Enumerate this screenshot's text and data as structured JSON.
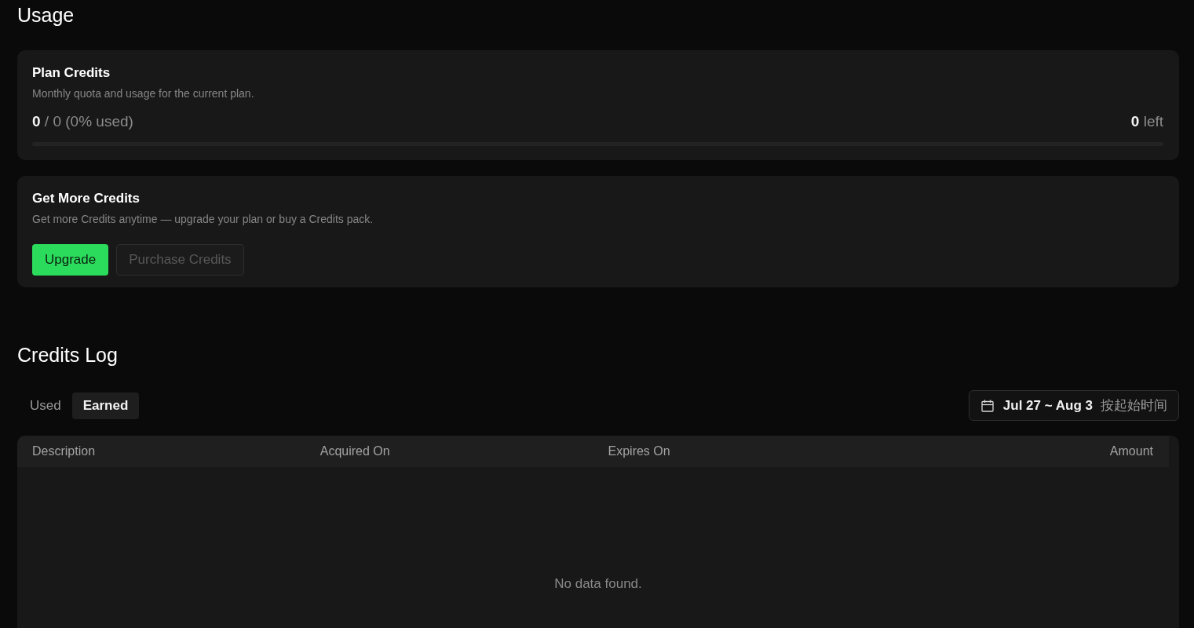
{
  "page_title": "Usage",
  "plan_credits": {
    "title": "Plan Credits",
    "description": "Monthly quota and usage for the current plan.",
    "usage": "**0** / 0 (0% used)",
    "remaining": "**0** left",
    "level": 0
  },
  "get_more_credits": {
    "title": "Get More Credits",
    "description": "Get more Credits anytime — upgrade your plan or buy a Credits pack.",
    "buttons": [
      {
        "label": "Upgrade",
        "kind": "primary",
        "disabled": false
      },
      {
        "label": "Purchase Credits",
        "kind": "outline",
        "disabled": true
      }
    ]
  },
  "credits_log": {
    "title": "Credits Log",
    "tabs": [
      {
        "label": "Used",
        "selected": false
      },
      {
        "label": "Earned",
        "selected": true
      }
    ],
    "date_filter": {
      "range": "Jul 27 ~ Aug 3",
      "mode": "按起始时间"
    },
    "table": {
      "columns": [
        "Description",
        "Acquired On",
        "Expires On",
        "Amount"
      ],
      "empty_message": "No data found."
    }
  }
}
